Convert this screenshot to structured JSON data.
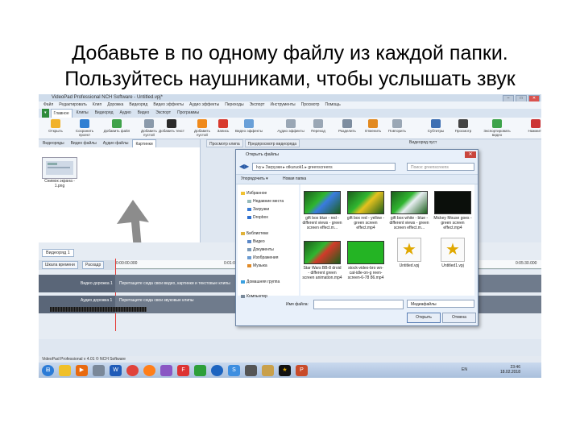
{
  "slide": {
    "title_line1": "Добавьте в  по одному файлу из каждой папки.",
    "title_line2": "Пользуйтесь наушниками, чтобы услышать звук"
  },
  "app": {
    "title": "VideoPad Professional NCH Software - Untitled.vpj*",
    "menu": [
      "Файл",
      "Редактировать",
      "Клип",
      "Дорожка",
      "Видеоряд",
      "Видео эффекты",
      "Аудио эффекты",
      "Переходы",
      "Экспорт",
      "Инструменты",
      "Просмотр",
      "Помощь"
    ],
    "tabs": [
      "Главное",
      "Клипы",
      "Видеоряд",
      "Аудио",
      "Видео",
      "Экспорт",
      "Программы"
    ],
    "ribbon": [
      "Открыть",
      "Сохранить проект",
      "Добавить файл",
      "Добавить пустой",
      "Добавить текст",
      "Добавить пустой",
      "Запись",
      "Видео эффекты",
      "Аудио эффекты",
      "Переход",
      "Разделить",
      "Отменить",
      "Повторить",
      "Субтитры",
      "Просмотр",
      "Экспортировать видео",
      "Нажмите"
    ],
    "panel_tabs": [
      "Видеоряды",
      "Видео файлы",
      "Аудио файлы",
      "Картинки"
    ],
    "thumb_label": "Снимок экрана - 1.png",
    "clip_tabs": [
      "Просмотр клипа",
      "Предпросмотр видеоряда"
    ],
    "preview_label": "Видеоряд пуст",
    "timeline": {
      "tab": "Видеоряд 1",
      "buttons": [
        "Шкала времени",
        "Раскадр"
      ],
      "ticks": [
        "0:00:00.000",
        "0:01:00.000",
        "0:05:30.000"
      ],
      "video_track": "Видео дорожка 1",
      "video_hint": "Перетащите сюда свои видео, картинки и текстовые клипы",
      "audio_track": "Аудио дорожка 1",
      "audio_hint": "Перетащите сюда свои звуковые клипы"
    },
    "status": "VideoPad Professional v 4.01 © NCH Software",
    "tray": {
      "lang": "EN",
      "time": "23:46",
      "date": "18.02.2018"
    }
  },
  "dialog": {
    "title": "Открыть файлы",
    "address": "Ivy ▸ Загрузки ▸ otkuruok1 ▸ greenscreens",
    "search_placeholder": "Поиск: greenscreens",
    "organize": "Упорядочить ▾",
    "new_folder": "Новая папка",
    "nav": [
      "Избранное",
      "Недавние места",
      "Загрузки",
      "Dropbox",
      "Библиотеки",
      "Видео",
      "Документы",
      "Изображения",
      "Музыка",
      "Домашняя группа",
      "Компьютер"
    ],
    "files": [
      {
        "name": "gift box blue - red - different views - green screen effect.m...",
        "style": "blue"
      },
      {
        "name": "gift box red - yellow - green screen effect.mp4",
        "style": "yellow"
      },
      {
        "name": "gift box white - blue - different views - green screen effect.m...",
        "style": "white"
      },
      {
        "name": "Mickey Mouse goes - green screen effect.mp4",
        "style": "dark"
      },
      {
        "name": "Star Wars BB-8 droid - different green screen animation.mp4",
        "style": "red"
      },
      {
        "name": "stock-video-bro wn-cat-idle-on-g reen-screen-6-78 86.mp4",
        "style": "green"
      },
      {
        "name": "Untitled.vpj",
        "style": "vpj"
      },
      {
        "name": "Untitled1.vpj",
        "style": "vpj"
      }
    ],
    "filename_label": "Имя файла:",
    "filter": "Медиафайлы",
    "open": "Открыть",
    "cancel": "Отмена"
  },
  "colors": {
    "accent_green": "#2e8b3c",
    "arrow": "#8c8c8c"
  }
}
